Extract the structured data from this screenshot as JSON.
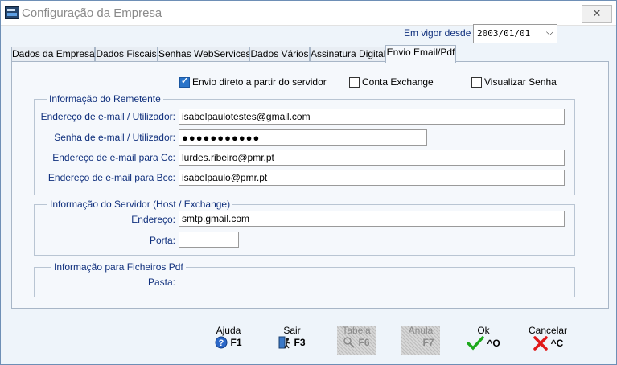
{
  "window": {
    "title": "Configuração da Empresa",
    "close_glyph": "✕"
  },
  "vigor": {
    "label": "Em vigor desde :",
    "value": "2003/01/01"
  },
  "tabs": [
    {
      "label": "Dados da Empresa"
    },
    {
      "label": "Dados Fiscais"
    },
    {
      "label": "Senhas WebServices"
    },
    {
      "label": "Dados Vários"
    },
    {
      "label": "Assinatura Digital"
    },
    {
      "label": "Envio Email/Pdf"
    }
  ],
  "options": {
    "envio_direto": {
      "label": "Envio direto a partir do servidor",
      "checked": true
    },
    "conta_exchange": {
      "label": "Conta Exchange",
      "checked": false
    },
    "visualizar_senha": {
      "label": "Visualizar Senha",
      "checked": false
    }
  },
  "remetente": {
    "legend": "Informação do Remetente",
    "email_label": "Endereço de e-mail / Utilizador:",
    "email_value": "isabelpaulotestes@gmail.com",
    "senha_label": "Senha de e-mail / Utilizador:",
    "senha_value": "●●●●●●●●●●●",
    "cc_label": "Endereço de e-mail para Cc:",
    "cc_value": "lurdes.ribeiro@pmr.pt",
    "bcc_label": "Endereço de e-mail para Bcc:",
    "bcc_value": "isabelpaulo@pmr.pt"
  },
  "servidor": {
    "legend": "Informação do Servidor (Host / Exchange)",
    "endereco_label": "Endereço:",
    "endereco_value": "smtp.gmail.com",
    "porta_label": "Porta:",
    "porta_value": ""
  },
  "pdf": {
    "legend": "Informação para Ficheiros Pdf",
    "pasta_label": "Pasta:"
  },
  "buttons": {
    "ajuda": {
      "label": "Ajuda",
      "key": "F1",
      "icon": "help-icon"
    },
    "sair": {
      "label": "Sair",
      "key": "F3",
      "icon": "exit-icon"
    },
    "tabela": {
      "label": "Tabela",
      "key": "F6",
      "icon": "table-icon"
    },
    "anula": {
      "label": "Anula",
      "key": "F7",
      "icon": "undo-icon"
    },
    "ok": {
      "label": "Ok",
      "key": "^O",
      "icon": "checkmark-icon"
    },
    "cancelar": {
      "label": "Cancelar",
      "key": "^C",
      "icon": "cancel-x-icon"
    }
  }
}
